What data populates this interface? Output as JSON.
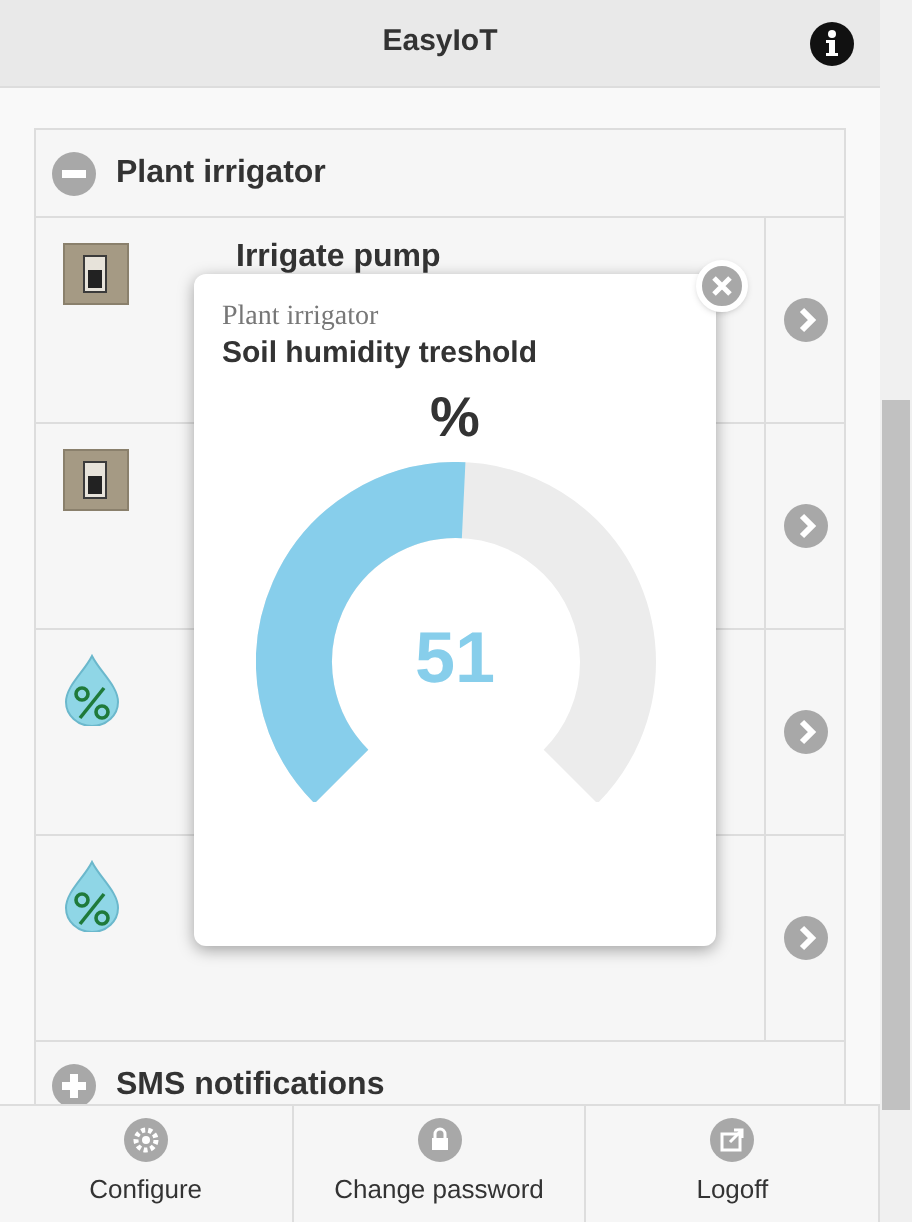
{
  "header": {
    "title": "EasyIoT"
  },
  "sections": [
    {
      "title": "Plant irrigator",
      "expanded": true,
      "rows": [
        {
          "kind": "switch",
          "title": "Irrigate pump"
        },
        {
          "kind": "switch"
        },
        {
          "kind": "humidity"
        },
        {
          "kind": "humidity"
        }
      ]
    },
    {
      "title": "SMS notifications",
      "expanded": false
    }
  ],
  "dialog": {
    "subtitle": "Plant irrigator",
    "title": "Soil humidity treshold",
    "unit": "%",
    "value": "51",
    "level": 0.51
  },
  "footer": [
    {
      "kind": "gear",
      "label": "Configure"
    },
    {
      "kind": "lock",
      "label": "Change password"
    },
    {
      "kind": "share",
      "label": "Logoff"
    }
  ]
}
